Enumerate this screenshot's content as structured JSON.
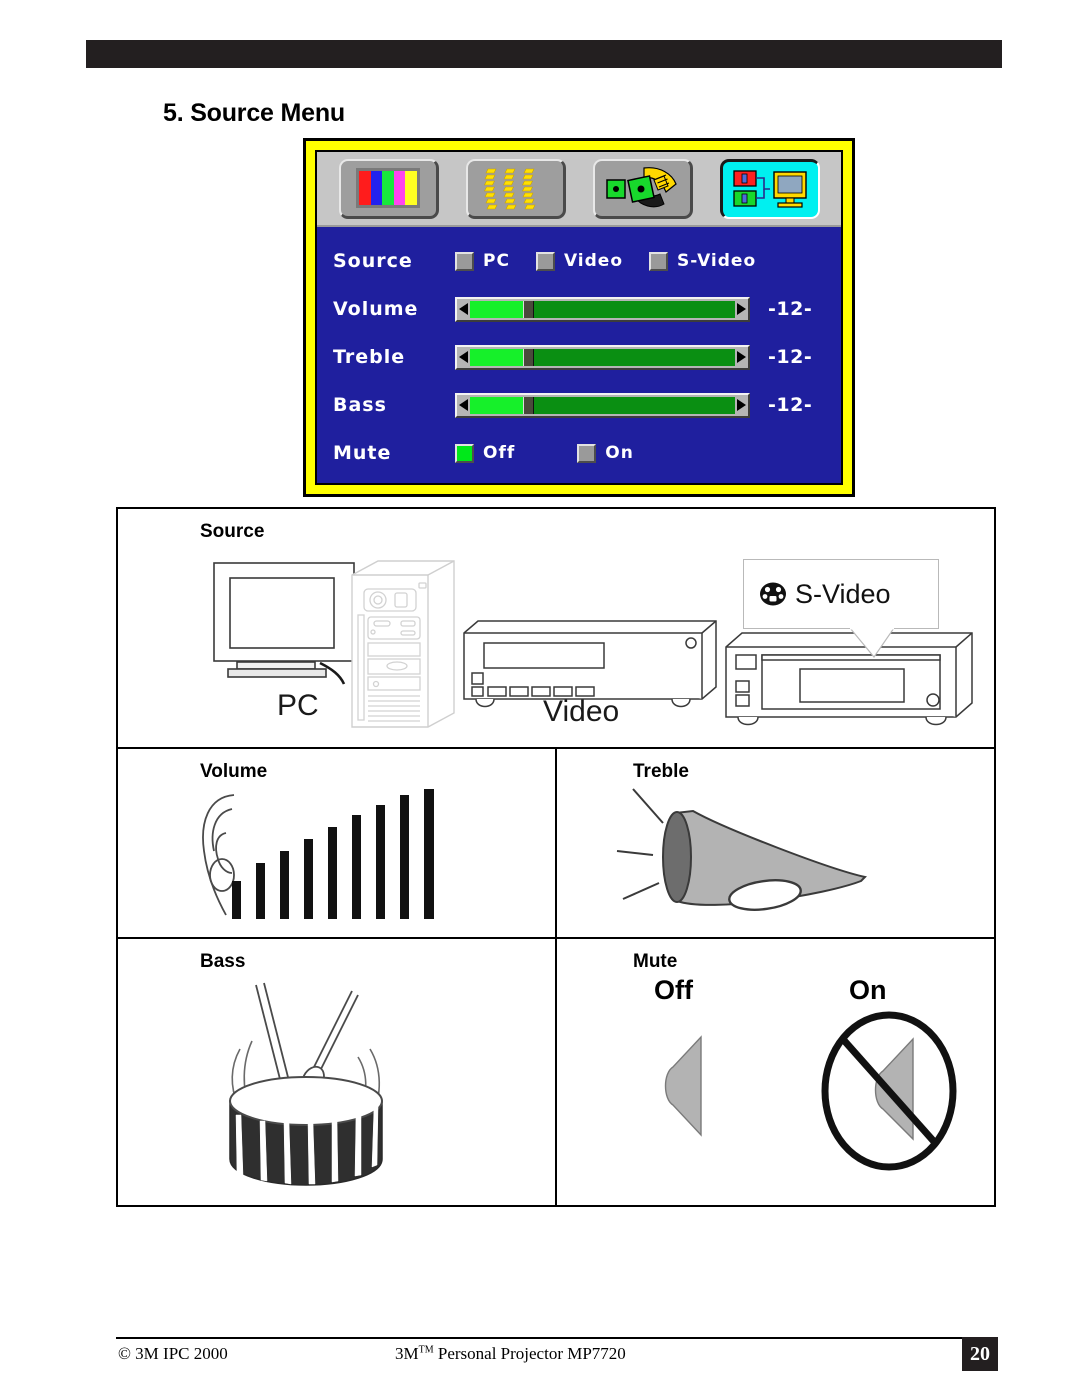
{
  "document": {
    "title": "5. Source Menu"
  },
  "osd": {
    "tabs": [
      {
        "name": "color-bars-tab",
        "icon": "color-bars-icon",
        "active": false
      },
      {
        "name": "keystone-tab",
        "icon": "keystone-arrows-icon",
        "active": false
      },
      {
        "name": "setup-tab",
        "icon": "wrench-tool-icon",
        "active": false
      },
      {
        "name": "source-tab",
        "icon": "source-wiring-icon",
        "active": true
      }
    ],
    "rows": {
      "source": {
        "label": "Source",
        "options": [
          {
            "label": "PC",
            "selected": false
          },
          {
            "label": "Video",
            "selected": false
          },
          {
            "label": "S-Video",
            "selected": false
          }
        ]
      },
      "volume": {
        "label": "Volume",
        "value": "-12-",
        "fill_percent": 20
      },
      "treble": {
        "label": "Treble",
        "value": "-12-",
        "fill_percent": 20
      },
      "bass": {
        "label": "Bass",
        "value": "-12-",
        "fill_percent": 20
      },
      "mute": {
        "label": "Mute",
        "options": [
          {
            "label": "Off",
            "selected": true
          },
          {
            "label": "On",
            "selected": false
          }
        ]
      }
    },
    "colors": {
      "frame_yellow": "#ffff00",
      "menu_blue": "#1f1f9e",
      "tab_strip_gray": "#c6c6c6",
      "active_tab_cyan": "#00f0f0",
      "slider_fill": "#16f02a",
      "slider_track": "#0a8f12",
      "checkbox_on": "#00e81a",
      "checkbox_off": "#9a9a9a"
    },
    "color_bars": [
      "#ff1c1c",
      "#2222ee",
      "#18e83c",
      "#ff44ee",
      "#ffff22"
    ]
  },
  "illustrations": {
    "source": {
      "caption": "Source",
      "pc_label": "PC",
      "video_label": "Video",
      "svideo_callout": "S-Video"
    },
    "volume": {
      "caption": "Volume"
    },
    "treble": {
      "caption": "Treble"
    },
    "bass": {
      "caption": "Bass"
    },
    "mute": {
      "caption": "Mute",
      "off_label": "Off",
      "on_label": "On"
    }
  },
  "footer": {
    "copyright": "© 3M IPC 2000",
    "product_prefix": "3M",
    "product_tm": "TM",
    "product_suffix": " Personal Projector MP7720",
    "page_number": "20"
  }
}
